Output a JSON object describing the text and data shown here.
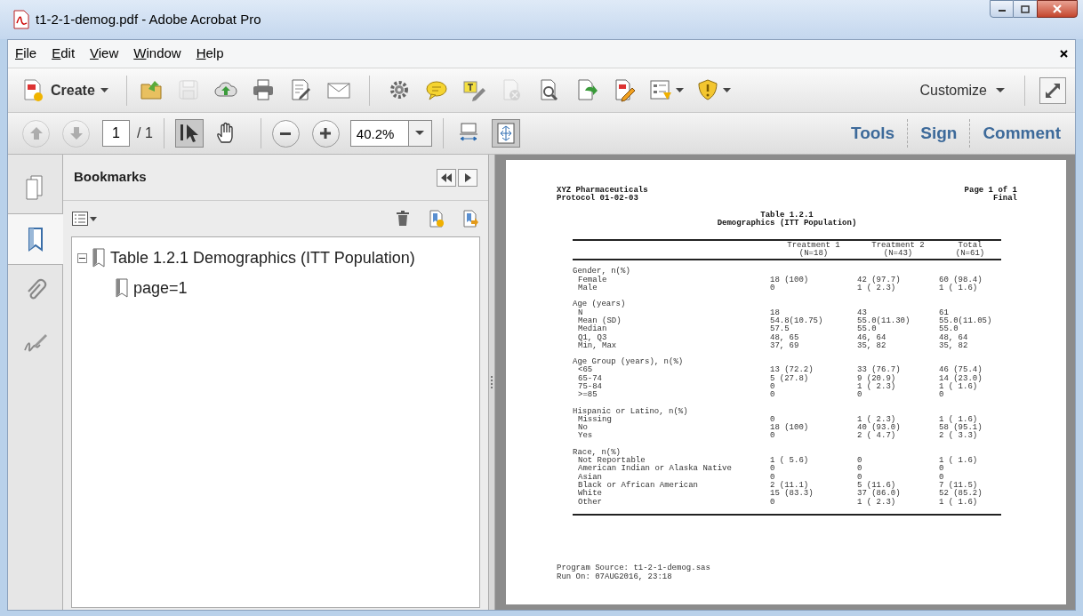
{
  "window": {
    "title": "t1-2-1-demog.pdf - Adobe Acrobat Pro"
  },
  "menu": [
    "File",
    "Edit",
    "View",
    "Window",
    "Help"
  ],
  "toolbar": {
    "create": "Create",
    "tools": [
      {
        "kind": "open",
        "disabled": false
      },
      {
        "kind": "save",
        "disabled": true
      },
      {
        "kind": "cloud",
        "disabled": false
      },
      {
        "kind": "print",
        "disabled": false
      },
      {
        "kind": "edit",
        "disabled": false
      },
      {
        "kind": "mail",
        "disabled": false
      }
    ],
    "tools_2": [
      {
        "kind": "gear",
        "disabled": false
      },
      {
        "kind": "comment",
        "disabled": false
      },
      {
        "kind": "highlight",
        "disabled": false
      },
      {
        "kind": "docx",
        "disabled": true
      },
      {
        "kind": "docsearch",
        "disabled": false
      },
      {
        "kind": "docarrow",
        "disabled": false
      },
      {
        "kind": "docedit",
        "disabled": false
      },
      {
        "kind": "form",
        "disabled": false
      },
      {
        "kind": "shield",
        "disabled": false
      }
    ],
    "customize": "Customize"
  },
  "nav": {
    "up_disabled": true,
    "down_disabled": true,
    "page": "1",
    "page_count": "/ 1",
    "modes": [
      {
        "kind": "select",
        "selected": true
      },
      {
        "kind": "hand",
        "selected": false
      }
    ],
    "zoom": "40.2%",
    "views": [
      {
        "kind": "fitwidth",
        "selected": false
      },
      {
        "kind": "fitpage",
        "selected": true
      }
    ],
    "panels": [
      "Tools",
      "Sign",
      "Comment"
    ]
  },
  "side_tabs": [
    {
      "kind": "pages",
      "selected": false
    },
    {
      "kind": "bookmarks",
      "selected": true
    },
    {
      "kind": "attachments",
      "selected": false
    },
    {
      "kind": "signatures",
      "selected": false
    }
  ],
  "bookmarks": {
    "title": "Bookmarks",
    "items": [
      {
        "label": "Table 1.2.1 Demographics (ITT Population)",
        "expanded": true,
        "children": [
          {
            "label": "page=1"
          }
        ]
      }
    ]
  },
  "document": {
    "header_left": [
      "XYZ Pharmaceuticals",
      "Protocol 01-02-03"
    ],
    "header_right": [
      "Page 1 of 1",
      "Final"
    ],
    "title": [
      "Table 1.2.1",
      "Demographics (ITT Population)"
    ],
    "columns": [
      {
        "label": "Treatment 1",
        "n": "(N=18)"
      },
      {
        "label": "Treatment 2",
        "n": "(N=43)"
      },
      {
        "label": "Total",
        "n": "(N=61)"
      }
    ],
    "sections": [
      {
        "label": "Gender, n(%)",
        "rows": [
          [
            "Female",
            "18 (100)",
            "42 (97.7)",
            "60 (98.4)"
          ],
          [
            "Male",
            "0",
            "1 ( 2.3)",
            "1 ( 1.6)"
          ]
        ]
      },
      {
        "label": "Age (years)",
        "rows": [
          [
            "N",
            "18",
            "43",
            "61"
          ],
          [
            "Mean (SD)",
            "54.8(10.75)",
            "55.0(11.30)",
            "55.0(11.05)"
          ],
          [
            "Median",
            "57.5",
            "55.0",
            "55.0"
          ],
          [
            "Q1, Q3",
            "48, 65",
            "46, 64",
            "48, 64"
          ],
          [
            "Min, Max",
            "37, 69",
            "35, 82",
            "35, 82"
          ]
        ]
      },
      {
        "label": "Age Group (years), n(%)",
        "rows": [
          [
            "<65",
            "13 (72.2)",
            "33 (76.7)",
            "46 (75.4)"
          ],
          [
            "65-74",
            "5 (27.8)",
            "9 (20.9)",
            "14 (23.0)"
          ],
          [
            "75-84",
            "0",
            "1 ( 2.3)",
            "1 ( 1.6)"
          ],
          [
            ">=85",
            "0",
            "0",
            "0"
          ]
        ]
      },
      {
        "label": "Hispanic or Latino, n(%)",
        "rows": [
          [
            "Missing",
            "0",
            "1 ( 2.3)",
            "1 ( 1.6)"
          ],
          [
            "No",
            "18 (100)",
            "40 (93.0)",
            "58 (95.1)"
          ],
          [
            "Yes",
            "0",
            "2 ( 4.7)",
            "2 ( 3.3)"
          ]
        ]
      },
      {
        "label": "Race, n(%)",
        "rows": [
          [
            "Not Reportable",
            "1 ( 5.6)",
            "0",
            "1 ( 1.6)"
          ],
          [
            "American Indian or Alaska Native",
            "0",
            "0",
            "0"
          ],
          [
            "Asian",
            "0",
            "0",
            "0"
          ],
          [
            "Black or African American",
            "2 (11.1)",
            "5 (11.6)",
            "7 (11.5)"
          ],
          [
            "White",
            "15 (83.3)",
            "37 (86.0)",
            "52 (85.2)"
          ],
          [
            "Other",
            "0",
            "1 ( 2.3)",
            "1 ( 1.6)"
          ]
        ]
      }
    ],
    "footer": [
      "Program Source: t1-2-1-demog.sas",
      "Run On: 07AUG2016, 23:18"
    ]
  }
}
